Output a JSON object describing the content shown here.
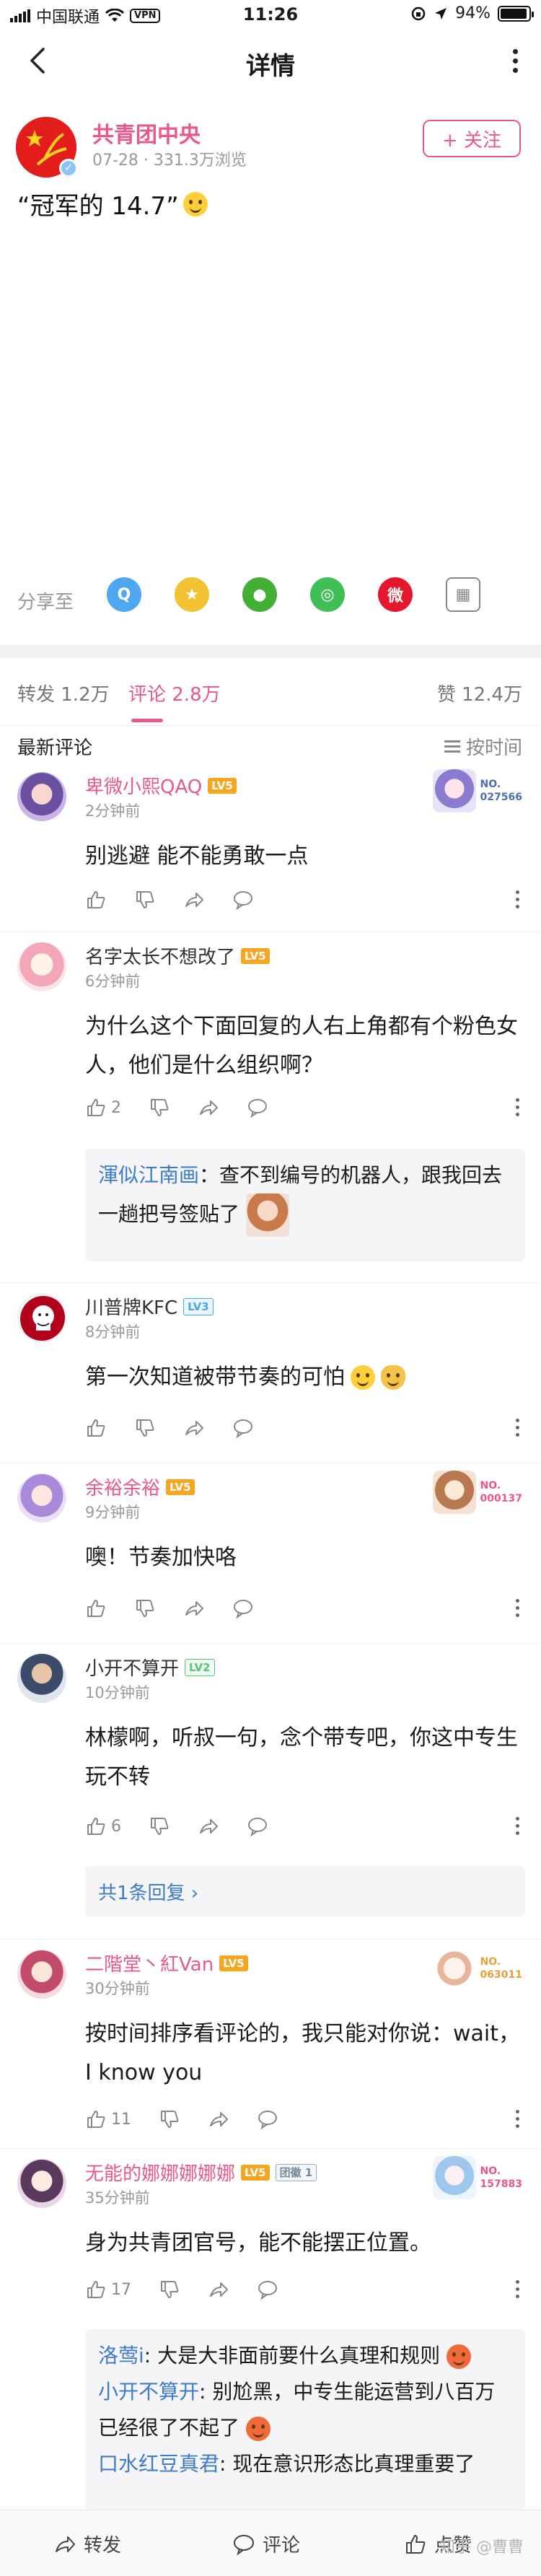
{
  "status_bar": {
    "carrier": "中国联通",
    "vpn": "VPN",
    "time": "11:26",
    "battery": "94%",
    "battery_level": 0.94
  },
  "nav": {
    "title": "详情"
  },
  "post": {
    "author": "共青团中央",
    "meta": "07-28 · 331.3万浏览",
    "follow_label": "+ 关注",
    "text": "“冠军的 14.7”"
  },
  "share": {
    "label": "分享至",
    "targets": [
      {
        "icon": "qq-icon",
        "color": "#4fa7ef",
        "glyph": "Q"
      },
      {
        "icon": "qzone-icon",
        "color": "#f3c233",
        "glyph": "★"
      },
      {
        "icon": "wechat-icon",
        "color": "#41b035",
        "glyph": "●"
      },
      {
        "icon": "moments-icon",
        "color": "#3fbf55",
        "glyph": "◎"
      },
      {
        "icon": "weibo-icon",
        "color": "#e6162d",
        "glyph": "微"
      },
      {
        "icon": "image-share-icon",
        "color": "#ffffff",
        "glyph": "▦"
      }
    ]
  },
  "tabs": {
    "repost": "转发 1.2万",
    "comment": "评论 2.8万",
    "like": "赞 12.4万"
  },
  "comments_header": {
    "title": "最新评论",
    "sort": "按时间"
  },
  "comments": [
    {
      "name": "卑微小熙QAQ",
      "level": "LV5",
      "time": "2分钟前",
      "text": "别逃避 能不能勇敢一点",
      "likes": "",
      "card_no": "NO.\n027566"
    },
    {
      "name": "名字太长不想改了",
      "level": "LV5",
      "time": "6分钟前",
      "text": "为什么这个下面回复的人右上角都有个粉色女人，他们是什么组织啊？",
      "likes": "2",
      "reply": {
        "name": "渾似江南画",
        "text": "：查不到编号的机器人，跟我回去一趟把号签贴了"
      }
    },
    {
      "name": "川普牌KFC",
      "level": "LV3",
      "time": "8分钟前",
      "text": "第一次知道被带节奏的可怕",
      "likes": ""
    },
    {
      "name": "余裕余裕",
      "level": "LV5",
      "time": "9分钟前",
      "text": "噢！节奏加快咯",
      "likes": "",
      "card_no": "NO.\n000137"
    },
    {
      "name": "小开不算开",
      "level": "LV2",
      "time": "10分钟前",
      "text": "林檬啊，听叔一句，念个带专吧，你这中专生玩不转",
      "likes": "6",
      "more_replies": "共1条回复 ›"
    },
    {
      "name": "二階堂丶紅Van",
      "level": "LV5",
      "time": "30分钟前",
      "text": "按时间排序看评论的，我只能对你说：wait，I know you",
      "likes": "11",
      "card_no": "NO.\n063011"
    },
    {
      "name": "无能的娜娜娜娜娜",
      "level": "LV5",
      "tag": "团徽 1",
      "time": "35分钟前",
      "text": "身为共青团官号，能不能摆正位置。",
      "likes": "17",
      "card_no": "NO.\n157883",
      "replies": [
        {
          "name": "洛莺i",
          "text": ": 大是大非面前要什么真理和规则"
        },
        {
          "name": "小开不算开",
          "text": ": 别尬黑，中专生能运营到八百万已经很了不起了"
        },
        {
          "name": "口水红豆真君",
          "text": ": 现在意识形态比真理重要了"
        }
      ]
    }
  ],
  "bottom_bar": {
    "repost": "转发",
    "comment": "评论",
    "like": "点赞",
    "watermark": "知乎 @曹曹"
  }
}
